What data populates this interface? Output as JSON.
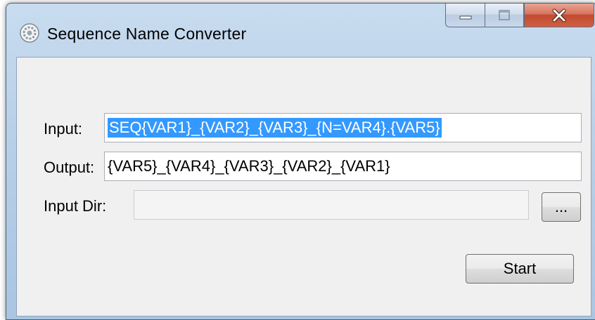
{
  "window": {
    "title": "Sequence Name Converter",
    "icon": "gear-icon",
    "caption_buttons": [
      "minimize-icon",
      "maximize-icon",
      "close-icon"
    ]
  },
  "form": {
    "input_label": "Input:",
    "input_value": "SEQ{VAR1}_{VAR2}_{VAR3}_{N=VAR4}.{VAR5}",
    "output_label": "Output:",
    "output_value": "{VAR5}_{VAR4}_{VAR3}_{VAR2}_{VAR1}",
    "input_dir_label": "Input Dir:",
    "input_dir_value": "",
    "browse_label": "...",
    "start_label": "Start"
  },
  "colors": {
    "selection": "#3399ff",
    "close_button": "#c24a30",
    "title_bar": "#b9d0e8"
  }
}
